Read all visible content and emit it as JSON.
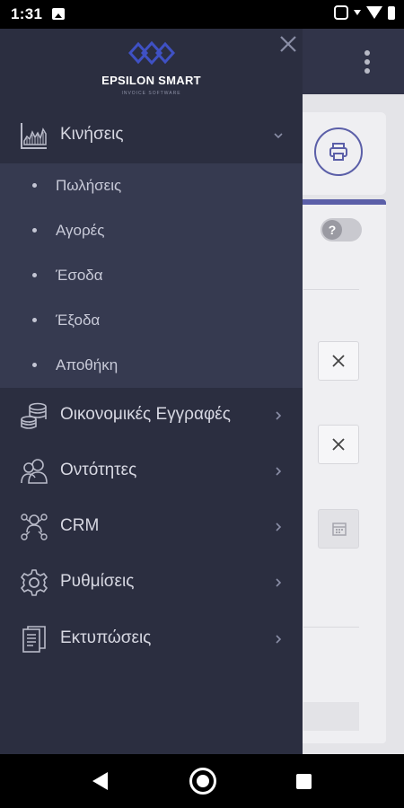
{
  "status_bar": {
    "time": "1:31"
  },
  "brand": {
    "name": "EPSILON SMART",
    "tagline": "INVOICE SOFTWARE",
    "accent": "#3f51c4"
  },
  "drawer": {
    "background": "#2b2e40",
    "submenu_background": "#363a50",
    "items": [
      {
        "label": "Κινήσεις",
        "icon": "chart-icon",
        "expanded": true
      },
      {
        "label": "Οικονομικές Εγγραφές",
        "icon": "coins-icon"
      },
      {
        "label": "Οντότητες",
        "icon": "users-icon"
      },
      {
        "label": "CRM",
        "icon": "crm-icon"
      },
      {
        "label": "Ρυθμίσεις",
        "icon": "gear-icon"
      },
      {
        "label": "Εκτυπώσεις",
        "icon": "document-icon"
      }
    ],
    "submenu": [
      {
        "label": "Πωλήσεις"
      },
      {
        "label": "Αγορές"
      },
      {
        "label": "Έσοδα"
      },
      {
        "label": "Έξοδα"
      },
      {
        "label": "Αποθήκη"
      }
    ]
  },
  "background_app": {
    "toggle_symbol": "?"
  }
}
